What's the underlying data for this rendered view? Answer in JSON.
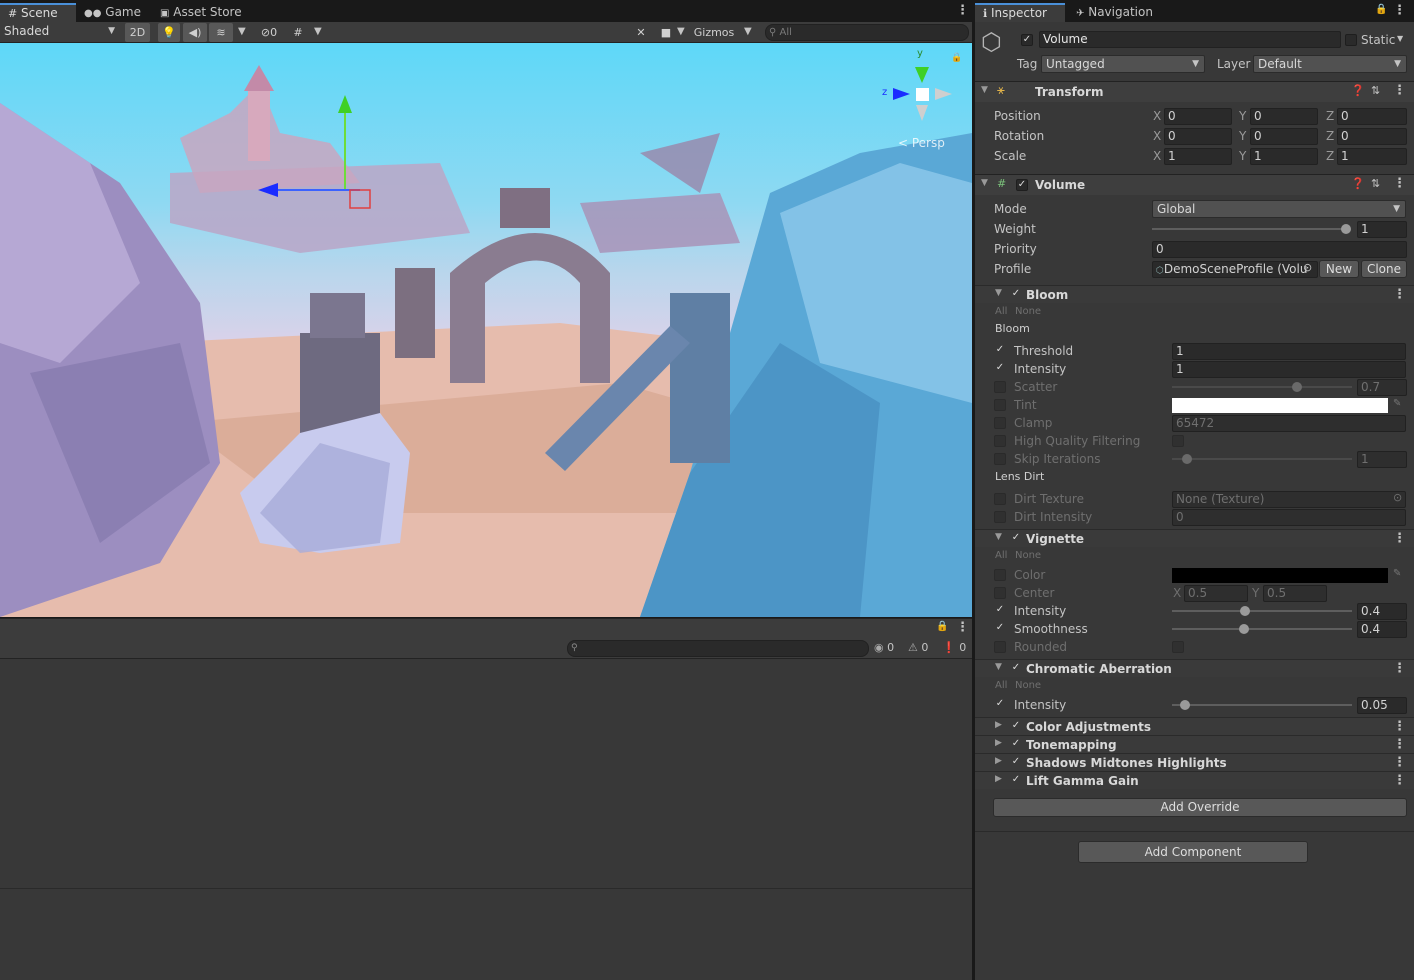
{
  "scene_tabs": {
    "scene": "Scene",
    "game": "Game",
    "asset_store": "Asset Store"
  },
  "scene_toolbar": {
    "shading": "Shaded",
    "mode_2d": "2D",
    "hidden_count": "0",
    "gizmos": "Gizmos",
    "search_placeholder": "All"
  },
  "scene_view": {
    "persp_label": "< Persp",
    "axis_x": "z",
    "axis_y": "y"
  },
  "console": {
    "info_count": "0",
    "warn_count": "0",
    "error_count": "0"
  },
  "inspector_tabs": {
    "inspector": "Inspector",
    "navigation": "Navigation"
  },
  "object": {
    "name": "Volume",
    "static_label": "Static",
    "tag_label": "Tag",
    "tag_value": "Untagged",
    "layer_label": "Layer",
    "layer_value": "Default"
  },
  "transform": {
    "title": "Transform",
    "rows": [
      {
        "label": "Position",
        "x": "0",
        "y": "0",
        "z": "0"
      },
      {
        "label": "Rotation",
        "x": "0",
        "y": "0",
        "z": "0"
      },
      {
        "label": "Scale",
        "x": "1",
        "y": "1",
        "z": "1"
      }
    ],
    "axis": {
      "x": "X",
      "y": "Y",
      "z": "Z"
    }
  },
  "volume": {
    "title": "Volume",
    "mode_label": "Mode",
    "mode_value": "Global",
    "weight_label": "Weight",
    "weight_value": "1",
    "priority_label": "Priority",
    "priority_value": "0",
    "profile_label": "Profile",
    "profile_value": "DemoSceneProfile (Volu",
    "new_btn": "New",
    "clone_btn": "Clone"
  },
  "bloom": {
    "title": "Bloom",
    "all": "All",
    "none": "None",
    "section": "Bloom",
    "threshold_label": "Threshold",
    "threshold_value": "1",
    "intensity_label": "Intensity",
    "intensity_value": "1",
    "scatter_label": "Scatter",
    "scatter_value": "0.7",
    "tint_label": "Tint",
    "clamp_label": "Clamp",
    "clamp_value": "65472",
    "hq_label": "High Quality Filtering",
    "skip_label": "Skip Iterations",
    "skip_value": "1",
    "lens_section": "Lens Dirt",
    "dirt_tex_label": "Dirt Texture",
    "dirt_tex_value": "None (Texture)",
    "dirt_int_label": "Dirt Intensity",
    "dirt_int_value": "0"
  },
  "vignette": {
    "title": "Vignette",
    "all": "All",
    "none": "None",
    "color_label": "Color",
    "center_label": "Center",
    "center_x": "0.5",
    "center_y": "0.5",
    "intensity_label": "Intensity",
    "intensity_value": "0.4",
    "smoothness_label": "Smoothness",
    "smoothness_value": "0.4",
    "rounded_label": "Rounded"
  },
  "chromatic": {
    "title": "Chromatic Aberration",
    "all": "All",
    "none": "None",
    "intensity_label": "Intensity",
    "intensity_value": "0.05"
  },
  "collapsed_overrides": [
    "Color Adjustments",
    "Tonemapping",
    "Shadows Midtones Highlights",
    "Lift Gamma Gain"
  ],
  "add_override": "Add Override",
  "add_component": "Add Component",
  "colors": {
    "accent": "#4a90d9",
    "panel": "#383838",
    "scene_sky": "#5ed8f8"
  }
}
